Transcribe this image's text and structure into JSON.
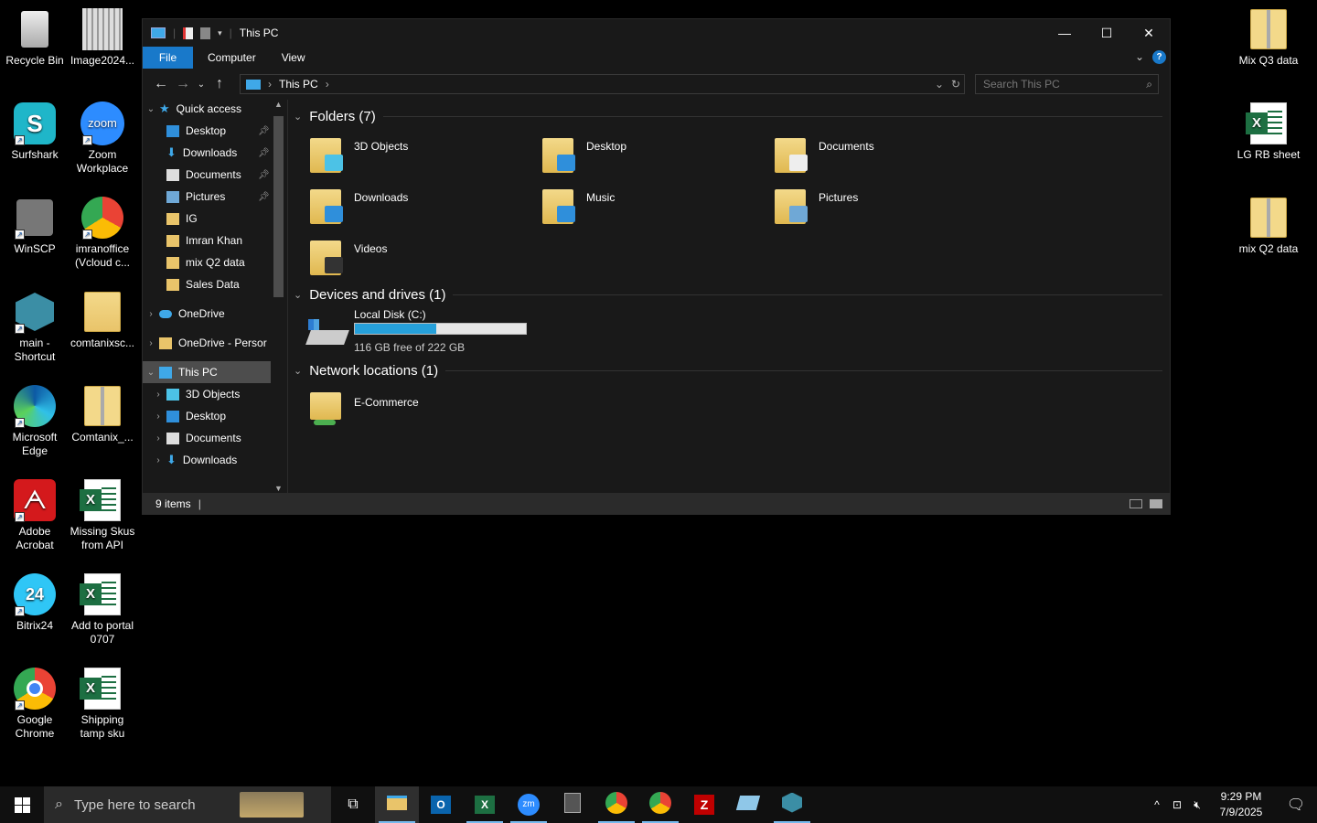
{
  "desktop": {
    "left_icons": [
      {
        "label": "Recycle Bin",
        "icon": "recycle-bin-icon"
      },
      {
        "label": "Image2024...",
        "icon": "image-file-icon"
      },
      {
        "label": "Surfshark",
        "icon": "surfshark-icon"
      },
      {
        "label": "Zoom Workplace",
        "icon": "zoom-icon"
      },
      {
        "label": "WinSCP",
        "icon": "winscp-icon"
      },
      {
        "label": "imranoffice (Vcloud c...",
        "icon": "chrome-profile-icon"
      },
      {
        "label": "main - Shortcut",
        "icon": "app-shortcut-icon"
      },
      {
        "label": "comtanixsc...",
        "icon": "folder-icon"
      },
      {
        "label": "Microsoft Edge",
        "icon": "edge-icon"
      },
      {
        "label": "Comtanix_...",
        "icon": "zip-folder-icon"
      },
      {
        "label": "Adobe Acrobat",
        "icon": "acrobat-icon"
      },
      {
        "label": "Missing Skus from API",
        "icon": "excel-file-icon"
      },
      {
        "label": "Bitrix24",
        "icon": "bitrix24-icon"
      },
      {
        "label": "Add to portal 0707",
        "icon": "excel-file-icon"
      },
      {
        "label": "Google Chrome",
        "icon": "chrome-icon"
      },
      {
        "label": "Shipping tamp sku",
        "icon": "excel-file-icon"
      }
    ],
    "right_icons": [
      {
        "label": "Mix Q3 data",
        "icon": "zip-folder-icon"
      },
      {
        "label": "LG RB sheet",
        "icon": "excel-file-icon"
      },
      {
        "label": "mix Q2 data",
        "icon": "zip-folder-icon"
      }
    ]
  },
  "explorer": {
    "title": "This PC",
    "ribbon_tabs": [
      "File",
      "Computer",
      "View"
    ],
    "address": {
      "crumb": "This PC"
    },
    "search_placeholder": "Search This PC",
    "nav": [
      {
        "label": "Quick access",
        "icon": "star-icon",
        "indent": 0,
        "expand": "expanded"
      },
      {
        "label": "Desktop",
        "icon": "desktop-icon",
        "indent": 1,
        "pinned": true
      },
      {
        "label": "Downloads",
        "icon": "download-icon",
        "indent": 1,
        "pinned": true
      },
      {
        "label": "Documents",
        "icon": "documents-icon",
        "indent": 1,
        "pinned": true
      },
      {
        "label": "Pictures",
        "icon": "pictures-icon",
        "indent": 1,
        "pinned": true
      },
      {
        "label": "IG",
        "icon": "folder-icon",
        "indent": 1
      },
      {
        "label": "Imran Khan",
        "icon": "folder-icon",
        "indent": 1
      },
      {
        "label": "mix Q2 data",
        "icon": "folder-icon",
        "indent": 1
      },
      {
        "label": "Sales Data",
        "icon": "folder-icon",
        "indent": 1
      },
      {
        "label": "OneDrive",
        "icon": "cloud-icon",
        "indent": 0,
        "expand": "collapsed"
      },
      {
        "label": "OneDrive - Persor",
        "icon": "folder-icon",
        "indent": 0,
        "expand": "collapsed"
      },
      {
        "label": "This PC",
        "icon": "computer-icon",
        "indent": 0,
        "expand": "expanded",
        "selected": true
      },
      {
        "label": "3D Objects",
        "icon": "cube-icon",
        "indent": 1,
        "expand": "collapsed"
      },
      {
        "label": "Desktop",
        "icon": "desktop-icon",
        "indent": 1,
        "expand": "collapsed"
      },
      {
        "label": "Documents",
        "icon": "documents-icon",
        "indent": 1,
        "expand": "collapsed"
      },
      {
        "label": "Downloads",
        "icon": "download-icon",
        "indent": 1,
        "expand": "collapsed"
      }
    ],
    "groups": {
      "folders": {
        "header": "Folders (7)",
        "items": [
          "3D Objects",
          "Desktop",
          "Documents",
          "Downloads",
          "Music",
          "Pictures",
          "Videos"
        ]
      },
      "drives": {
        "header": "Devices and drives (1)",
        "name": "Local Disk (C:)",
        "free_text": "116 GB free of 222 GB",
        "used_fraction": 0.477
      },
      "network": {
        "header": "Network locations (1)",
        "items": [
          "E-Commerce"
        ]
      }
    },
    "status": "9 items"
  },
  "taskbar": {
    "search_placeholder": "Type here to search",
    "apps": [
      "task-view",
      "file-explorer",
      "outlook",
      "excel",
      "zoom",
      "calculator",
      "chrome",
      "chrome-profile",
      "filezilla",
      "notes",
      "app"
    ],
    "time": "9:29 PM",
    "date": "7/9/2025"
  },
  "colors": {
    "accent": "#1979ca",
    "drive_fill": "#26a0da",
    "window_bg": "#191919"
  }
}
